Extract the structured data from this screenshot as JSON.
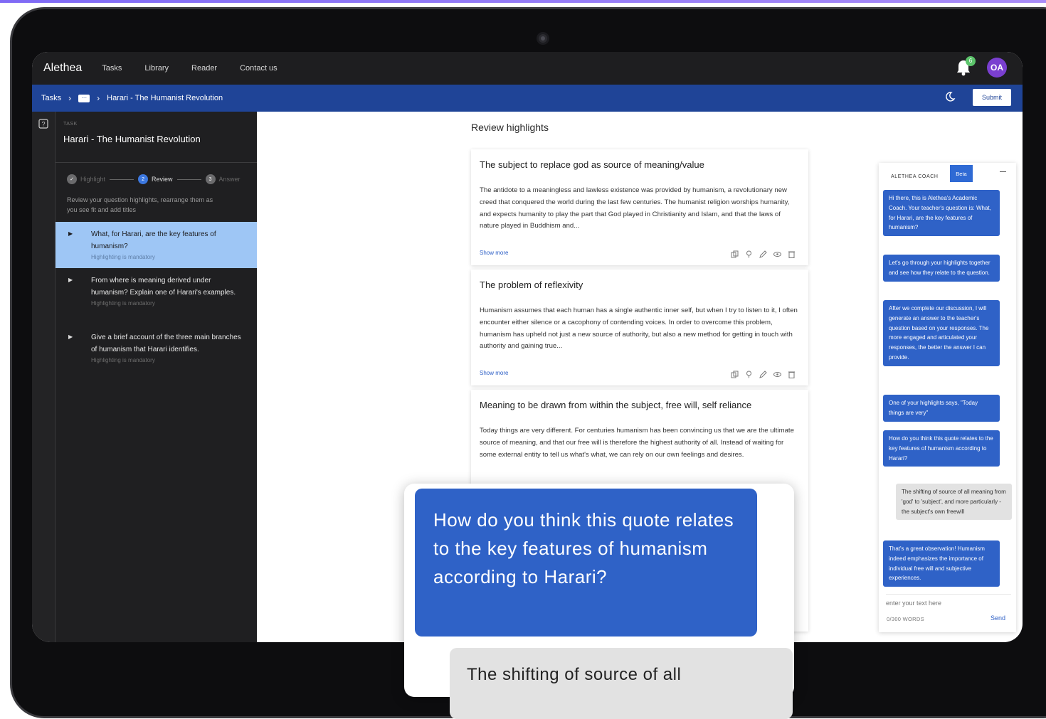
{
  "nav": {
    "brand": "Alethea",
    "links": [
      "Tasks",
      "Library",
      "Reader",
      "Contact us"
    ],
    "notification_count": "6",
    "avatar_initials": "OA"
  },
  "breadcrumb": {
    "root": "Tasks",
    "more": "···",
    "current": "Harari - The Humanist Revolution",
    "submit_label": "Submit"
  },
  "sidebar": {
    "caption": "TASK",
    "title": "Harari - The Humanist Revolution",
    "steps": [
      {
        "num": "✓",
        "label": "Highlight"
      },
      {
        "num": "2",
        "label": "Review"
      },
      {
        "num": "3",
        "label": "Answer"
      }
    ],
    "hint": "Review your question highlights, rearrange them as you see fit and add titles",
    "questions": [
      {
        "text": "What, for Harari, are the key features of humanism?",
        "sub": "Highlighting is mandatory"
      },
      {
        "text": "From where is meaning derived under humanism? Explain one of Harari's examples.",
        "sub": "Highlighting is mandatory"
      },
      {
        "text": "Give a brief account of the three main branches of humanism that Harari identifies.",
        "sub": "Highlighting is mandatory"
      }
    ]
  },
  "main": {
    "title": "Review highlights",
    "cards": [
      {
        "title": "The subject to replace god as source of meaning/value",
        "body": "The antidote to a meaningless and lawless existence was provided by humanism, a revolutionary new creed that conquered the world during the last few centuries. The humanist religion worships humanity, and expects humanity to play the part that God played in Christianity and Islam, and that the laws of nature played in Buddhism and...",
        "show_more": "Show more"
      },
      {
        "title": "The problem of reflexivity",
        "body": "Humanism assumes that each human has a single authentic inner self, but when I try to listen to it, I often encounter either silence or a cacophony of contending voices. In order to overcome this problem, humanism has upheld not just a new source of authority, but also a new method for getting in touch with authority and gaining true...",
        "show_more": "Show more"
      },
      {
        "title": "Meaning to be drawn from within the subject, free will, self reliance",
        "body": "Today things are very different. For centuries humanism has been convincing us that we are the ultimate source of meaning, and that our free will is therefore the highest authority of all. Instead of waiting for some external entity to tell us what's what, we can rely on our own feelings and desires."
      }
    ]
  },
  "coach": {
    "header": "ALETHEA COACH",
    "beta": "Beta",
    "messages": [
      {
        "role": "bot",
        "text": "Hi there, this is Alethea's Academic Coach. Your teacher's question is: What, for Harari, are the key features of humanism?"
      },
      {
        "role": "bot",
        "text": "Let's go through your highlights together and see how they relate to the question."
      },
      {
        "role": "bot",
        "text": "After we complete our discussion, I will generate an answer to the teacher's question based on your responses. The more engaged and articulated your responses, the better the answer I can provide."
      },
      {
        "role": "bot",
        "text": "One of your highlights says, \"Today things are very\""
      },
      {
        "role": "bot",
        "text": "How do you think this quote relates to the key features of humanism according to Harari?"
      },
      {
        "role": "user",
        "text": "The shifting of source of all meaning from 'god' to 'subject', and more particularly - the subject's own freewill"
      },
      {
        "role": "bot",
        "text": "That's a great observation! Humanism indeed emphasizes the importance of individual free will and subjective experiences."
      }
    ],
    "input_placeholder": "enter your text here",
    "word_count": "0/300 WORDS",
    "send_label": "Send"
  },
  "callout": {
    "bot_text": "How do you think this quote relates to the key features of humanism according to Harari?",
    "user_text": "The shifting of source of all"
  }
}
